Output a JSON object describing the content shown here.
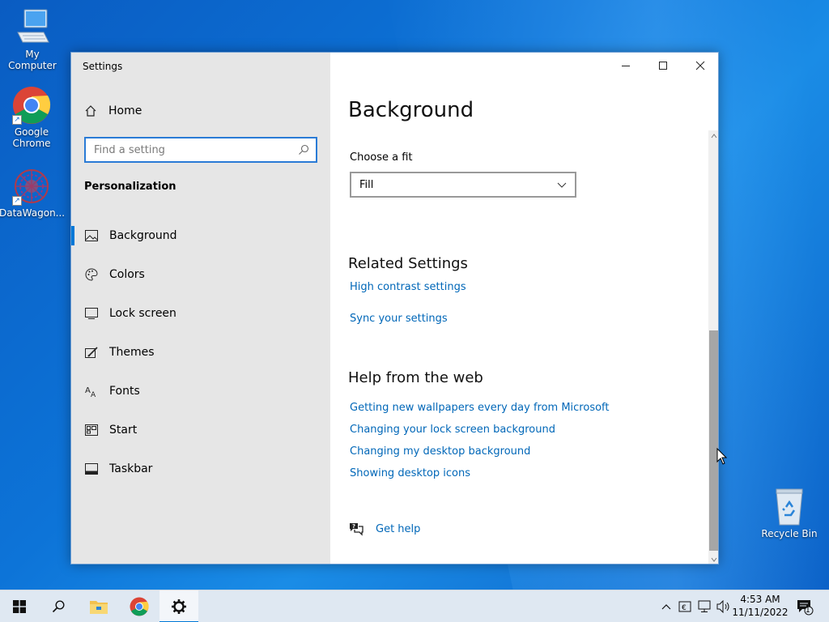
{
  "desktop": {
    "icons": [
      {
        "label": "My Computer"
      },
      {
        "label": "Google Chrome"
      },
      {
        "label": "DataWagon..."
      },
      {
        "label": "Recycle Bin"
      }
    ]
  },
  "window": {
    "title": "Settings",
    "sidebar": {
      "home_label": "Home",
      "search_placeholder": "Find a setting",
      "section_title": "Personalization",
      "items": [
        {
          "label": "Background",
          "icon": "picture-icon",
          "active": true
        },
        {
          "label": "Colors",
          "icon": "palette-icon"
        },
        {
          "label": "Lock screen",
          "icon": "lock-screen-icon"
        },
        {
          "label": "Themes",
          "icon": "themes-icon"
        },
        {
          "label": "Fonts",
          "icon": "fonts-icon"
        },
        {
          "label": "Start",
          "icon": "start-icon"
        },
        {
          "label": "Taskbar",
          "icon": "taskbar-icon"
        }
      ]
    },
    "main": {
      "title": "Background",
      "fit_label": "Choose a fit",
      "fit_value": "Fill",
      "related_title": "Related Settings",
      "related_links": [
        "High contrast settings",
        "Sync your settings"
      ],
      "help_title": "Help from the web",
      "help_links": [
        "Getting new wallpapers every day from Microsoft",
        "Changing your lock screen background",
        "Changing my desktop background",
        "Showing desktop icons"
      ],
      "get_help": "Get help"
    }
  },
  "taskbar": {
    "time": "4:53 AM",
    "date": "11/11/2022",
    "notification_count": "1"
  },
  "colors": {
    "accent": "#0078d7",
    "link": "#0067b8"
  }
}
